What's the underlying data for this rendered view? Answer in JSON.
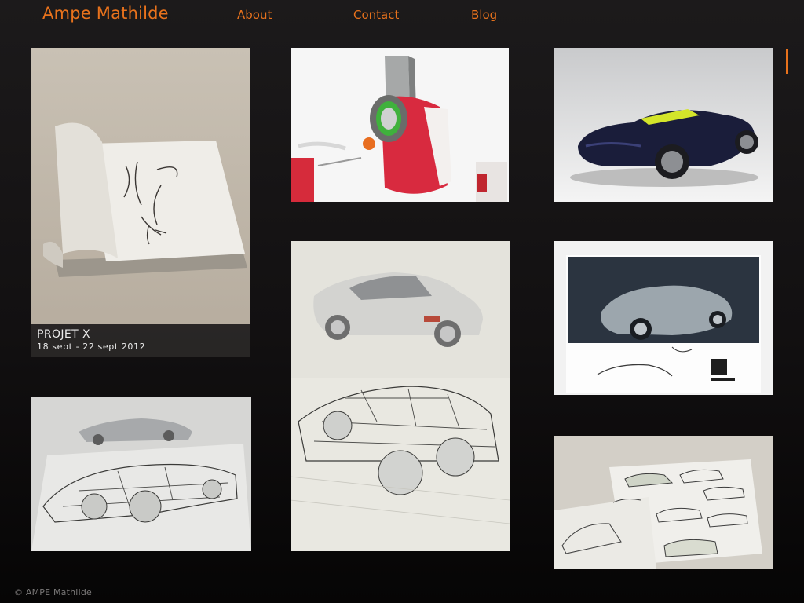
{
  "header": {
    "brand": "Ampe Mathilde",
    "nav": [
      {
        "label": "About"
      },
      {
        "label": "Contact"
      },
      {
        "label": "Blog"
      }
    ]
  },
  "gallery": {
    "featured": {
      "title": "PROJET X",
      "dates": "18 sept - 22 sept 2012"
    }
  },
  "footer": {
    "copyright": "© AMPE Mathilde"
  },
  "colors": {
    "accent": "#e8721c",
    "background": "#141213"
  },
  "icons": {
    "scroll_indicator": "vertical-bar"
  }
}
